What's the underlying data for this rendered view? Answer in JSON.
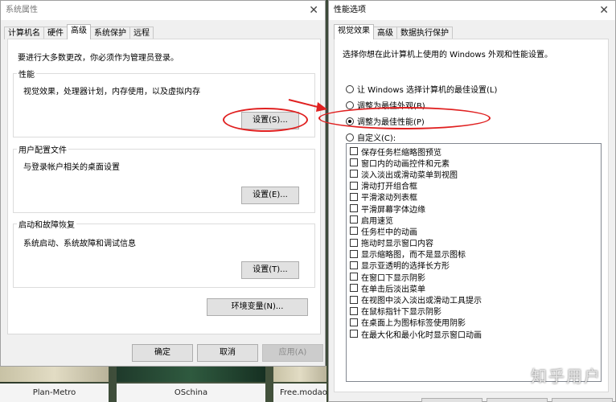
{
  "background": {
    "thumbnails": [
      {
        "caption": "Plan-Metro"
      },
      {
        "caption": "OSchina"
      },
      {
        "caption": "Free.modao.co"
      }
    ],
    "watermark": "知乎用户"
  },
  "sys_props": {
    "title": "系统属性",
    "tabs": [
      "计算机名",
      "硬件",
      "高级",
      "系统保护",
      "远程"
    ],
    "active_tab": "高级",
    "admin_note": "要进行大多数更改，你必须作为管理员登录。",
    "performance": {
      "label": "性能",
      "desc": "视觉效果，处理器计划，内存使用，以及虚拟内存",
      "button": "设置(S)..."
    },
    "profiles": {
      "label": "用户配置文件",
      "desc": "与登录帐户相关的桌面设置",
      "button": "设置(E)..."
    },
    "startup": {
      "label": "启动和故障恢复",
      "desc": "系统启动、系统故障和调试信息",
      "button": "设置(T)..."
    },
    "env_button": "环境变量(N)...",
    "ok": "确定",
    "cancel": "取消",
    "apply": "应用(A)"
  },
  "perf_opts": {
    "title": "性能选项",
    "tabs": [
      "视觉效果",
      "高级",
      "数据执行保护"
    ],
    "active_tab": "视觉效果",
    "intro": "选择你想在此计算机上使用的 Windows 外观和性能设置。",
    "radios": [
      {
        "label": "让 Windows 选择计算机的最佳设置(L)",
        "checked": false
      },
      {
        "label": "调整为最佳外观(B)",
        "checked": false
      },
      {
        "label": "调整为最佳性能(P)",
        "checked": true
      },
      {
        "label": "自定义(C):",
        "checked": false
      }
    ],
    "checkboxes": [
      "保存任务栏缩略图预览",
      "窗口内的动画控件和元素",
      "淡入淡出或滑动菜单到视图",
      "滑动打开组合框",
      "平滑滚动列表框",
      "平滑屏幕字体边缘",
      "启用速览",
      "任务栏中的动画",
      "拖动时显示窗口内容",
      "显示缩略图，而不是显示图标",
      "显示亚透明的选择长方形",
      "在窗口下显示阴影",
      "在单击后淡出菜单",
      "在视图中淡入淡出或滑动工具提示",
      "在鼠标指针下显示阴影",
      "在桌面上为图标标签使用阴影",
      "在最大化和最小化时显示窗口动画"
    ]
  },
  "colors": {
    "annotation": "#e02020"
  }
}
